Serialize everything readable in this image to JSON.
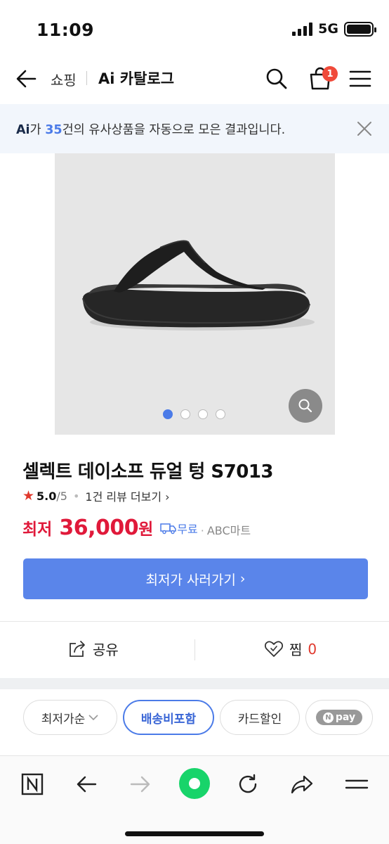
{
  "status_bar": {
    "time": "11:09",
    "network": "5G"
  },
  "header": {
    "breadcrumb": "쇼핑",
    "title": "Ai 카탈로그",
    "cart_badge": "1"
  },
  "ai_notice": {
    "ai_mark": "Ai",
    "prefix": "가 ",
    "count": "35",
    "suffix": "건의 유사상품을 자동으로 모은 결과입니다."
  },
  "carousel": {
    "slide_count": 4,
    "active_index": 0
  },
  "product": {
    "name": "셀렉트 데이소프 듀얼 텅 S7013",
    "rating": "5.0",
    "rating_max": "/5",
    "reviews": "1건 리뷰 더보기",
    "price_prefix": "최저",
    "price_value": "36,000",
    "price_unit": "원",
    "shipping": "무료",
    "seller": "ABC마트",
    "buy_label": "최저가 사러가기"
  },
  "actions": {
    "share": "공유",
    "like": "찜",
    "like_count": "0"
  },
  "filters": {
    "sort": "최저가순",
    "items": [
      "배송비포함",
      "카드할인"
    ],
    "npay": "pay"
  },
  "colors": {
    "accent": "#5a85ea",
    "price": "#e0193a",
    "badge": "#f04a3a"
  }
}
